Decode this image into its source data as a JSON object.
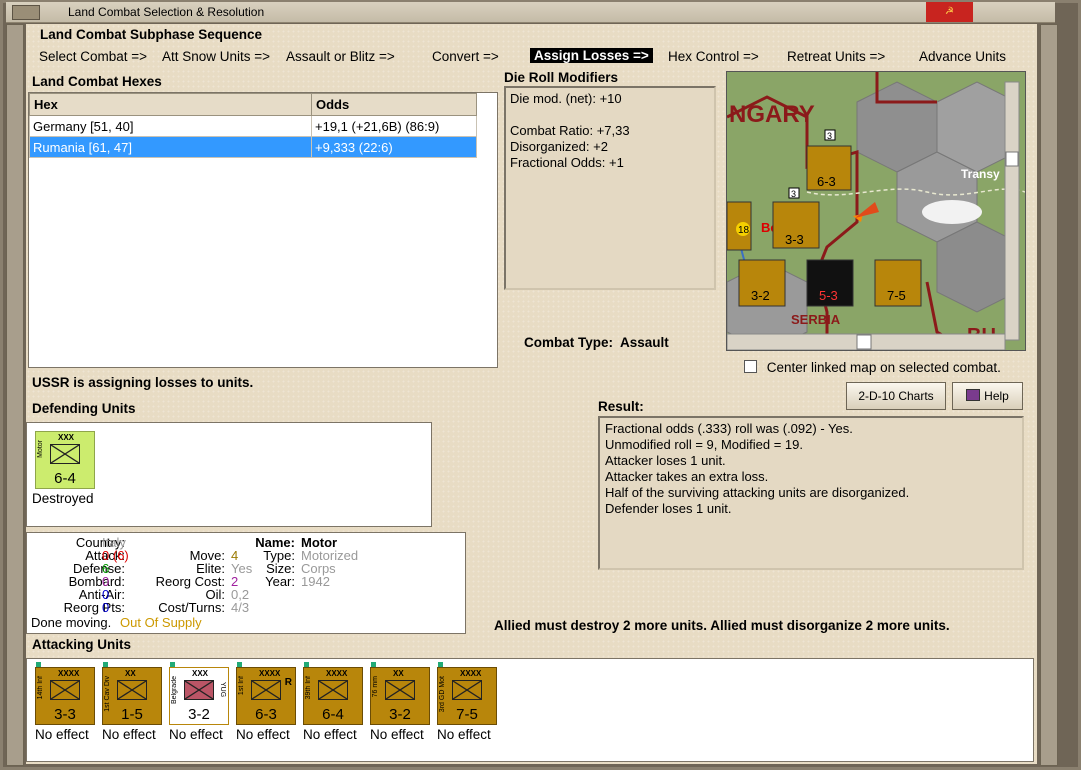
{
  "window": {
    "title": "Land Combat Selection & Resolution"
  },
  "phase": {
    "header": "Land Combat Subphase Sequence",
    "steps": [
      "Select Combat =>",
      "Att Snow Units =>",
      "Assault or Blitz =>",
      "Convert =>",
      "Assign Losses =>",
      "Hex Control =>",
      "Retreat Units =>",
      "Advance Units"
    ],
    "active_index": 4
  },
  "hexes": {
    "header": "Land Combat Hexes",
    "col_hex": "Hex",
    "col_odds": "Odds",
    "rows": [
      {
        "hex": "Germany [51, 40]",
        "odds": "+19,1 (+21,6B) (86:9)"
      },
      {
        "hex": "Rumania [61, 47]",
        "odds": "+9,333 (22:6)"
      }
    ],
    "selected_index": 1
  },
  "modifiers": {
    "header": "Die Roll Modifiers",
    "lines": [
      "Die mod. (net): +10",
      "",
      "Combat Ratio: +7,33",
      "Disorganized: +2",
      "Fractional Odds: +1"
    ]
  },
  "combat_type": {
    "label": "Combat Type:",
    "value": "Assault"
  },
  "center_map": {
    "label": "Center linked map on selected combat.",
    "checked": false
  },
  "buttons": {
    "charts": "2-D-10 Charts",
    "help": "Help"
  },
  "status": "USSR is assigning losses to units.",
  "defending": {
    "header": "Defending Units",
    "units": [
      {
        "type": "Motor",
        "size": "XXX",
        "strength": "6-4",
        "status": "Destroyed",
        "color": "#ccec6e"
      }
    ]
  },
  "details": {
    "country_k": "Country:",
    "country_v": "Italy",
    "attack_k": "Attack:",
    "attack_v": "0",
    "attack_v2": "(6)",
    "defense_k": "Defense:",
    "defense_v": "6",
    "bombard_k": "Bombard:",
    "bombard_v": "0",
    "antiair_k": "Anti-Air:",
    "antiair_v": "0",
    "reorgpts_k": "Reorg Pts:",
    "reorgpts_v": "0",
    "done_k": "Done moving.",
    "done_v": "Out Of Supply",
    "move_k": "Move:",
    "move_v": "4",
    "elite_k": "Elite:",
    "elite_v": "Yes",
    "reorgcost_k": "Reorg Cost:",
    "reorgcost_v": "2",
    "oil_k": "Oil:",
    "oil_v": "0,2",
    "costturns_k": "Cost/Turns:",
    "costturns_v": "4/3",
    "name_k": "Name:",
    "name_v": "Motor",
    "type_k": "Type:",
    "type_v": "Motorized",
    "size_k": "Size:",
    "size_v": "Corps",
    "year_k": "Year:",
    "year_v": "1942"
  },
  "result": {
    "header": "Result:",
    "lines": [
      "Fractional odds (.333) roll was (.092)  - Yes.",
      "Unmodified roll = 9, Modified = 19.",
      "Attacker loses 1 unit.",
      "Attacker takes an extra loss.",
      "Half of the surviving attacking units are disorganized.",
      "Defender loses 1 unit."
    ]
  },
  "allied_msg": "Allied must destroy 2 more units. Allied must disorganize 2 more units.",
  "attacking": {
    "header": "Attacking Units",
    "units": [
      {
        "side": "14th Inf",
        "size": "XXXX",
        "strength": "3-3",
        "status": "No effect"
      },
      {
        "side": "1st Cav Div",
        "size": "XX",
        "strength": "1-5",
        "status": "No effect"
      },
      {
        "side": "Belgrade",
        "size": "XXX",
        "strength": "3-2",
        "status": "No effect",
        "tag": "YUG",
        "highlight": true
      },
      {
        "side": "1st Inf",
        "size": "XXXX",
        "strength": "6-3",
        "status": "No effect",
        "mark": "R"
      },
      {
        "side": "39th Inf",
        "size": "XXXX",
        "strength": "6-4",
        "status": "No effect"
      },
      {
        "side": "76 mm",
        "size": "XX",
        "strength": "3-2",
        "status": "No effect"
      },
      {
        "side": "3rd GD Mot",
        "size": "XXXX",
        "strength": "7-5",
        "status": "No effect"
      }
    ]
  },
  "map": {
    "label_hungary": "NGARY",
    "label_serbia": "SERBIA",
    "label_transy": "Transy",
    "label_bu": "BU",
    "counters": [
      "6-3",
      "3-3",
      "3-2",
      "5-3",
      "7-5"
    ],
    "stack_counts": [
      "3",
      "3"
    ],
    "hex_number": "18",
    "city": "Be"
  },
  "colors": {
    "counter": "#b8860b",
    "defender": "#ccec6e",
    "selection": "#3399ff",
    "panel": "#e4d9c3"
  }
}
